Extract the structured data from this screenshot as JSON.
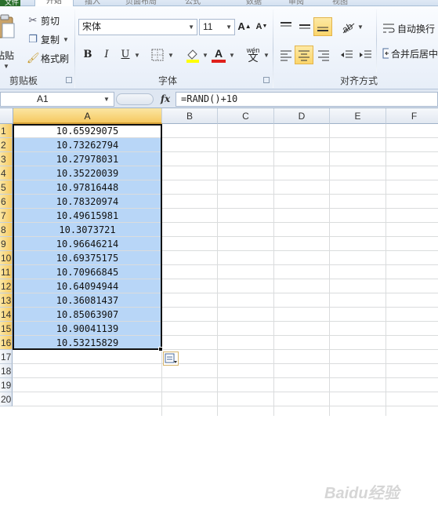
{
  "ribbon": {
    "tabs": {
      "file": "文件",
      "home": "开始",
      "others": [
        "插入",
        "页面布局",
        "公式",
        "数据",
        "审阅",
        "视图"
      ]
    },
    "clipboard": {
      "paste": "粘贴",
      "cut": "剪切",
      "copy": "复制",
      "format_painter": "格式刷",
      "group_label": "剪贴板"
    },
    "font": {
      "font_name": "宋体",
      "font_size": "11",
      "bold": "B",
      "italic": "I",
      "underline": "U",
      "phonetic": "wén",
      "group_label": "字体"
    },
    "alignment": {
      "wrap_text": "自动换行",
      "merge_center": "合并后居中",
      "group_label": "对齐方式"
    }
  },
  "formula_bar": {
    "name_box": "A1",
    "fx": "fx",
    "formula": "=RAND()+10"
  },
  "sheet": {
    "columns": [
      "A",
      "B",
      "C",
      "D",
      "E",
      "F"
    ],
    "rows": [
      "1",
      "2",
      "3",
      "4",
      "5",
      "6",
      "7",
      "8",
      "9",
      "10",
      "11",
      "12",
      "13",
      "14",
      "15",
      "16",
      "17",
      "18",
      "19",
      "20"
    ],
    "cells_a": [
      "10.65929075",
      "10.73262794",
      "10.27978031",
      "10.35220039",
      "10.97816448",
      "10.78320974",
      "10.49615981",
      "10.3073721",
      "10.96646214",
      "10.69375175",
      "10.70966845",
      "10.64094944",
      "10.36081437",
      "10.85063907",
      "10.90041139",
      "10.53215829"
    ]
  },
  "watermark": "Baidu经验",
  "colors": {
    "selection_fill": "#b8d6f7",
    "header_highlight": "#f6c961",
    "file_tab": "#2a6f2c"
  },
  "icons": [
    "paste-icon",
    "cut-icon",
    "copy-icon",
    "format-painter-icon",
    "grow-font-icon",
    "shrink-font-icon",
    "border-icon",
    "fill-color-icon",
    "font-color-icon",
    "phonetic-icon",
    "align-top-icon",
    "align-middle-icon",
    "align-bottom-icon",
    "orientation-icon",
    "align-left-icon",
    "align-center-icon",
    "align-right-icon",
    "decrease-indent-icon",
    "increase-indent-icon",
    "wrap-text-icon",
    "merge-icon",
    "paste-options-icon"
  ]
}
